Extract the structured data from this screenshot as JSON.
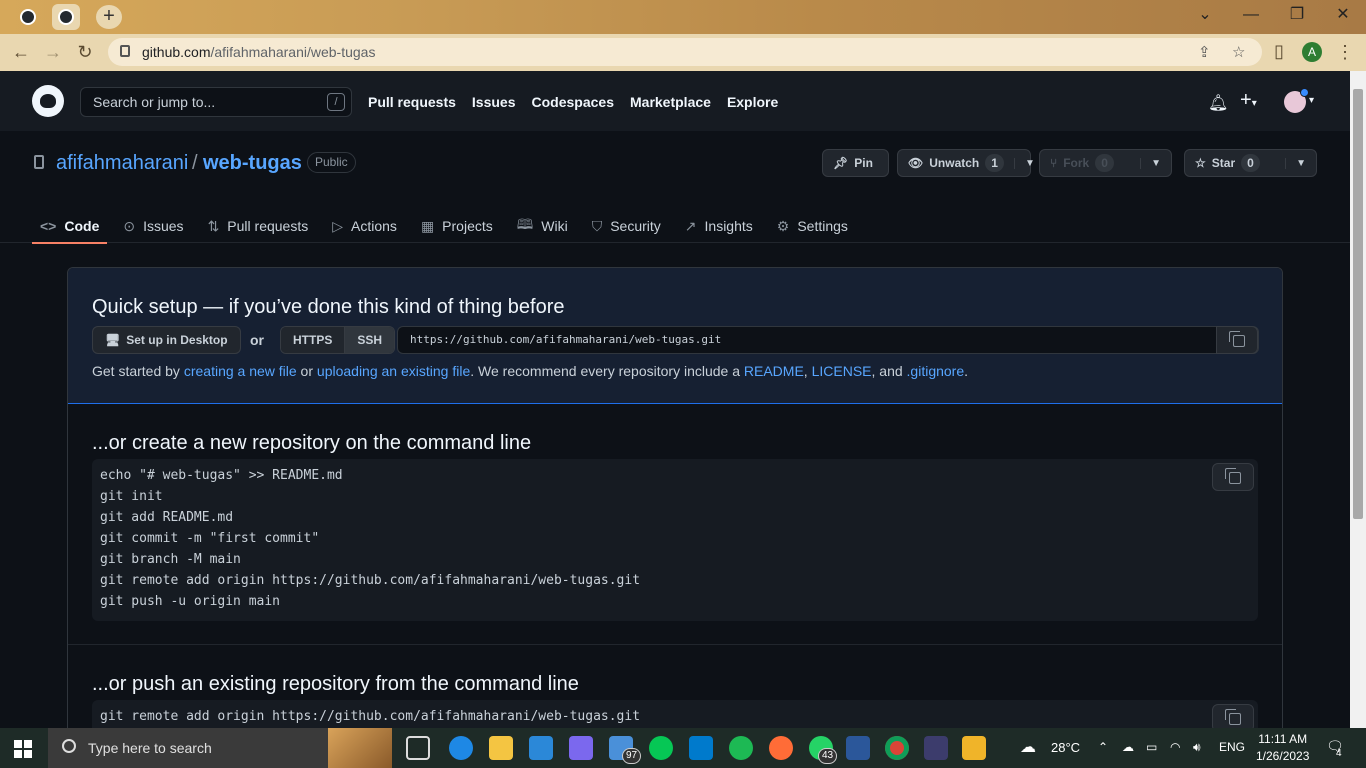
{
  "browser": {
    "url_host": "github.com",
    "url_path": "/afifahmaharani/web-tugas",
    "profile_initial": "A"
  },
  "header": {
    "search_placeholder": "Search or jump to...",
    "search_shortcut": "/",
    "nav": [
      "Pull requests",
      "Issues",
      "Codespaces",
      "Marketplace",
      "Explore"
    ]
  },
  "repo": {
    "owner": "afifahmaharani",
    "separator": "/",
    "name": "web-tugas",
    "visibility": "Public",
    "pin_label": "Pin",
    "unwatch_label": "Unwatch",
    "unwatch_count": "1",
    "fork_label": "Fork",
    "fork_count": "0",
    "star_label": "Star",
    "star_count": "0"
  },
  "tabs": [
    {
      "label": "Code",
      "icon": "code-icon"
    },
    {
      "label": "Issues",
      "icon": "issue-icon"
    },
    {
      "label": "Pull requests",
      "icon": "pull-request-icon"
    },
    {
      "label": "Actions",
      "icon": "play-icon"
    },
    {
      "label": "Projects",
      "icon": "table-icon"
    },
    {
      "label": "Wiki",
      "icon": "book-icon"
    },
    {
      "label": "Security",
      "icon": "shield-icon"
    },
    {
      "label": "Insights",
      "icon": "graph-icon"
    },
    {
      "label": "Settings",
      "icon": "gear-icon"
    }
  ],
  "quick_setup": {
    "title": "Quick setup — if you’ve done this kind of thing before",
    "desktop_button": "Set up in Desktop",
    "or": "or",
    "https": "HTTPS",
    "ssh": "SSH",
    "clone_url": "https://github.com/afifahmaharani/web-tugas.git",
    "hint_prefix": "Get started by ",
    "hint_link1": "creating a new file",
    "hint_or": " or ",
    "hint_link2": "uploading an existing file",
    "hint_mid": ". We recommend every repository include a ",
    "hint_readme": "README",
    "hint_comma": ", ",
    "hint_license": "LICENSE",
    "hint_and": ", and ",
    "hint_gitignore": ".gitignore",
    "hint_end": "."
  },
  "new_repo": {
    "title": "...or create a new repository on the command line",
    "code": "echo \"# web-tugas\" >> README.md\ngit init\ngit add README.md\ngit commit -m \"first commit\"\ngit branch -M main\ngit remote add origin https://github.com/afifahmaharani/web-tugas.git\ngit push -u origin main"
  },
  "push_existing": {
    "title": "...or push an existing repository from the command line",
    "code": "git remote add origin https://github.com/afifahmaharani/web-tugas.git"
  },
  "taskbar": {
    "search_text": "Type here to search",
    "badge_mail": "97",
    "badge_whatsapp": "43",
    "weather": "28°C",
    "lang": "ENG",
    "time": "11:11 AM",
    "date": "1/26/2023",
    "notifications": "4"
  }
}
